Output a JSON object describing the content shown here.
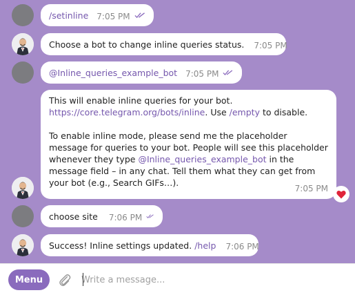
{
  "messages": [
    {
      "text": "/setinline",
      "time": "7:05 PM"
    },
    {
      "text": "Choose a bot to change inline queries status.",
      "time": "7:05 PM"
    },
    {
      "text": "@Inline_queries_example_bot",
      "time": "7:05 PM"
    },
    {
      "p1_a": "This will enable inline queries for your bot.",
      "p1_link": "https://core.telegram.org/bots/inline",
      "p1_mid": ". Use ",
      "p1_cmd": "/empty",
      "p1_end": " to disable.",
      "p2_a": "To enable inline mode, please send me the placeholder message for queries to your bot. People will see this placeholder whenever they type ",
      "p2_mention": "@Inline_queries_example_bot",
      "p2_b": " in the message field – in any chat. Tell them what they can get from your bot (e.g., Search GIFs…).",
      "time": "7:05 PM",
      "reaction": "heart-icon"
    },
    {
      "text": "choose site",
      "time": "7:06 PM"
    },
    {
      "text_a": "Success! Inline settings updated. ",
      "cmd": "/help",
      "time": "7:06 PM"
    }
  ],
  "composer": {
    "menu_label": "Menu",
    "placeholder": "Write a message..."
  },
  "colors": {
    "background": "#a58bc9",
    "accent": "#8a6bbd",
    "link": "#7557ad",
    "reaction": "#e0243a"
  }
}
